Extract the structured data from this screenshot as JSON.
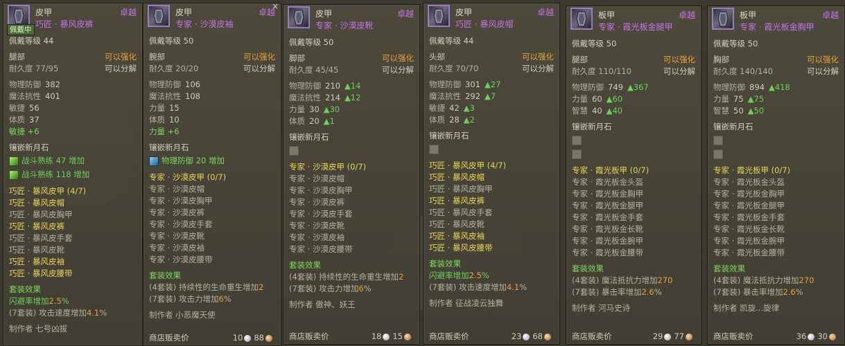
{
  "tooltips": [
    {
      "type": "皮甲",
      "rarity": "卓越",
      "name": "巧匠 · 暴风皮裤",
      "equipped": "佩戴中",
      "icon": "leather-pants-icon",
      "level_label": "佩戴等级 44",
      "slot": "腿部",
      "enhance": "可以强化",
      "durability": "耐久度 77/95",
      "decompose": "可以分解",
      "stats": [
        {
          "name": "物理防御",
          "value": "382"
        },
        {
          "name": "魔法抗性",
          "value": "401"
        },
        {
          "name": "敏捷",
          "value": "56"
        },
        {
          "name": "体质",
          "value": "37"
        }
      ],
      "bonus": "敏捷 +6",
      "socket_title": "镶嵌新月石",
      "gems": [
        {
          "text": "战斗熟练 47 增加",
          "color": "green"
        },
        {
          "text": "战斗熟练 118 增加",
          "color": "green"
        }
      ],
      "set_name": "巧匠 · 暴风皮甲 (4/7)",
      "set_items": [
        {
          "text": "巧匠 · 暴风皮帽",
          "active": true
        },
        {
          "text": "巧匠 · 暴风皮胸甲",
          "active": false
        },
        {
          "text": "巧匠 · 暴风皮裤",
          "active": true
        },
        {
          "text": "巧匠 · 暴风皮手套",
          "active": false
        },
        {
          "text": "巧匠 · 暴风皮靴",
          "active": false
        },
        {
          "text": "巧匠 · 暴风皮袖",
          "active": true
        },
        {
          "text": "巧匠 · 暴风皮腰带",
          "active": true
        }
      ],
      "set_effect_title": "套装效果",
      "set_effects": [
        {
          "prefix": "闪避率增加",
          "value": "2.5",
          "suffix": "%",
          "active": true
        },
        {
          "prefix": "(7套装) 攻击速度增加",
          "value": "4.1",
          "suffix": "%",
          "active": false
        }
      ],
      "maker": "制作者 七号凶拔",
      "price_label": "",
      "silver": "",
      "copper": ""
    },
    {
      "type": "皮甲",
      "rarity": "卓越",
      "name": "专家 · 沙漠皮袖",
      "equipped": "",
      "icon": "leather-sleeve-icon",
      "level_label": "佩戴等级 50",
      "slot": "腕部",
      "enhance": "可以强化",
      "durability": "耐久度 20/20",
      "decompose": "可以分解",
      "stats": [
        {
          "name": "物理防御",
          "value": "106"
        },
        {
          "name": "魔法抗性",
          "value": "108"
        },
        {
          "name": "力量",
          "value": "15"
        },
        {
          "name": "体质",
          "value": "10"
        }
      ],
      "bonus": "力量 +6",
      "socket_title": "镶嵌新月石",
      "gems": [
        {
          "text": "物理防御 20 增加",
          "color": "blue"
        }
      ],
      "set_name": "专家 · 沙漠皮甲 (0/7)",
      "set_items": [
        {
          "text": "专家 · 沙漠皮帽",
          "active": false
        },
        {
          "text": "专家 · 沙漠皮胸甲",
          "active": false
        },
        {
          "text": "专家 · 沙漠皮裤",
          "active": false
        },
        {
          "text": "专家 · 沙漠皮手套",
          "active": false
        },
        {
          "text": "专家 · 沙漠皮靴",
          "active": false
        },
        {
          "text": "专家 · 沙漠皮袖",
          "active": false
        },
        {
          "text": "专家 · 沙漠皮腰带",
          "active": false
        }
      ],
      "set_effect_title": "套装效果",
      "set_effects": [
        {
          "prefix": "(4套装) 持续性的生命重生增加",
          "value": "2",
          "suffix": "",
          "active": false
        },
        {
          "prefix": "(7套装) 攻击力增加",
          "value": "6",
          "suffix": "%",
          "active": false
        }
      ],
      "maker": "制作者 小恶魔天使",
      "price_label": "商店贩卖价",
      "silver": "10",
      "copper": "88"
    },
    {
      "type": "皮甲",
      "rarity": "卓越",
      "name": "专家 · 沙漠皮靴",
      "equipped": "",
      "icon": "leather-boots-icon",
      "level_label": "佩戴等级 50",
      "slot": "脚部",
      "enhance": "可以强化",
      "durability": "耐久度 45/45",
      "decompose": "可以分解",
      "stats": [
        {
          "name": "物理防御",
          "value": "210",
          "up": "▲14"
        },
        {
          "name": "魔法抗性",
          "value": "214",
          "up": "▲12"
        },
        {
          "name": "力量",
          "value": "30",
          "up": "▲30"
        },
        {
          "name": "体质",
          "value": "20",
          "up": "▲1"
        }
      ],
      "bonus": "",
      "socket_title": "镶嵌新月石",
      "gems": [
        {
          "text": "",
          "color": "empty"
        }
      ],
      "set_name": "专家 · 沙漠皮甲 (0/7)",
      "set_items": [
        {
          "text": "专家 · 沙漠皮帽",
          "active": false
        },
        {
          "text": "专家 · 沙漠皮胸甲",
          "active": false
        },
        {
          "text": "专家 · 沙漠皮裤",
          "active": false
        },
        {
          "text": "专家 · 沙漠皮手套",
          "active": false
        },
        {
          "text": "专家 · 沙漠皮靴",
          "active": false
        },
        {
          "text": "专家 · 沙漠皮袖",
          "active": false
        },
        {
          "text": "专家 · 沙漠皮腰带",
          "active": false
        }
      ],
      "set_effect_title": "套装效果",
      "set_effects": [
        {
          "prefix": "(4套装) 持续性的生命重生增加",
          "value": "2",
          "suffix": "",
          "active": false
        },
        {
          "prefix": "(7套装) 攻击力增加",
          "value": "6",
          "suffix": "%",
          "active": false
        }
      ],
      "maker": "制作者 傲神、妖王",
      "price_label": "商店贩卖价",
      "silver": "18",
      "copper": "15"
    },
    {
      "type": "皮甲",
      "rarity": "卓越",
      "name": "巧匠 · 暴风皮帽",
      "equipped": "",
      "icon": "leather-hat-icon",
      "level_label": "佩戴等级 44",
      "slot": "头部",
      "enhance": "可以强化",
      "durability": "耐久度 70/70",
      "decompose": "可以分解",
      "stats": [
        {
          "name": "物理防御",
          "value": "301",
          "up": "▲27"
        },
        {
          "name": "魔法抗性",
          "value": "292",
          "up": "▲7"
        },
        {
          "name": "敏捷",
          "value": "42",
          "up": "▲3"
        },
        {
          "name": "体质",
          "value": "28",
          "up": "▲2"
        }
      ],
      "bonus": "",
      "socket_title": "镶嵌新月石",
      "gems": [
        {
          "text": "",
          "color": "empty"
        }
      ],
      "set_name": "巧匠 · 暴风皮甲 (4/7)",
      "set_items": [
        {
          "text": "巧匠 · 暴风皮帽",
          "active": true
        },
        {
          "text": "巧匠 · 暴风皮胸甲",
          "active": false
        },
        {
          "text": "巧匠 · 暴风皮裤",
          "active": true
        },
        {
          "text": "巧匠 · 暴风皮手套",
          "active": false
        },
        {
          "text": "巧匠 · 暴风皮靴",
          "active": false
        },
        {
          "text": "巧匠 · 暴风皮袖",
          "active": true
        },
        {
          "text": "巧匠 · 暴风皮腰带",
          "active": true
        }
      ],
      "set_effect_title": "套装效果",
      "set_effects": [
        {
          "prefix": "闪避率增加",
          "value": "2.5",
          "suffix": "%",
          "active": true
        },
        {
          "prefix": "(7套装) 攻击速度增加",
          "value": "4.1",
          "suffix": "%",
          "active": false
        }
      ],
      "maker": "制作者 征战凌云独舞",
      "price_label": "商店贩卖价",
      "silver": "23",
      "copper": "68"
    },
    {
      "type": "板甲",
      "rarity": "卓越",
      "name": "专家 · 霞光板金腿甲",
      "equipped": "",
      "icon": "plate-greaves-icon",
      "level_label": "佩戴等级 50",
      "slot": "腿部",
      "enhance": "可以强化",
      "durability": "耐久度 110/110",
      "decompose": "可以分解",
      "stats": [
        {
          "name": "物理防御",
          "value": "749",
          "up": "▲367"
        },
        {
          "name": "力量",
          "value": "60",
          "up": "▲60"
        },
        {
          "name": "智慧",
          "value": "40",
          "up": "▲40"
        }
      ],
      "bonus": "",
      "socket_title": "镶嵌新月石",
      "gems": [
        {
          "text": "",
          "color": "empty"
        },
        {
          "text": "",
          "color": "empty"
        }
      ],
      "set_name": "专家 · 霞光板甲 (0/7)",
      "set_items": [
        {
          "text": "专家 · 霞光板金头盔",
          "active": false
        },
        {
          "text": "专家 · 霞光板金胸甲",
          "active": false
        },
        {
          "text": "专家 · 霞光板金腿甲",
          "active": false
        },
        {
          "text": "专家 · 霞光板金手套",
          "active": false
        },
        {
          "text": "专家 · 霞光板金长靴",
          "active": false
        },
        {
          "text": "专家 · 霞光板金腕甲",
          "active": false
        },
        {
          "text": "专家 · 霞光板金腰带",
          "active": false
        }
      ],
      "set_effect_title": "套装效果",
      "set_effects": [
        {
          "prefix": "(4套装) 魔法抵抗力增加",
          "value": "270",
          "suffix": "",
          "active": false
        },
        {
          "prefix": "(7套装) 暴击率增加",
          "value": "2.6",
          "suffix": "%",
          "active": false
        }
      ],
      "maker": "制作者 河马史诗",
      "price_label": "商店贩卖价",
      "silver": "29",
      "copper": "77"
    },
    {
      "type": "板甲",
      "rarity": "卓越",
      "name": "专家 · 霞光板金胸甲",
      "equipped": "",
      "icon": "plate-chest-icon",
      "level_label": "佩戴等级 50",
      "slot": "胸部",
      "enhance": "可以强化",
      "durability": "耐久度 140/140",
      "decompose": "可以分解",
      "stats": [
        {
          "name": "物理防御",
          "value": "894",
          "up": "▲418"
        },
        {
          "name": "力量",
          "value": "75",
          "up": "▲75"
        },
        {
          "name": "智慧",
          "value": "50",
          "up": "▲50"
        }
      ],
      "bonus": "",
      "socket_title": "镶嵌新月石",
      "gems": [
        {
          "text": "",
          "color": "empty"
        },
        {
          "text": "",
          "color": "empty"
        }
      ],
      "set_name": "专家 · 霞光板甲 (0/7)",
      "set_items": [
        {
          "text": "专家 · 霞光板金头盔",
          "active": false
        },
        {
          "text": "专家 · 霞光板金胸甲",
          "active": false
        },
        {
          "text": "专家 · 霞光板金腿甲",
          "active": false
        },
        {
          "text": "专家 · 霞光板金手套",
          "active": false
        },
        {
          "text": "专家 · 霞光板金长靴",
          "active": false
        },
        {
          "text": "专家 · 霞光板金腕甲",
          "active": false
        },
        {
          "text": "专家 · 霞光板金腰带",
          "active": false
        }
      ],
      "set_effect_title": "套装效果",
      "set_effects": [
        {
          "prefix": "(4套装) 魔法抵抗力增加",
          "value": "270",
          "suffix": "",
          "active": false
        },
        {
          "prefix": "(7套装) 暴击率增加",
          "value": "2.6",
          "suffix": "%",
          "active": false
        }
      ],
      "maker": "制作者 凯旋...旋律",
      "price_label": "商店贩卖价",
      "silver": "36",
      "copper": "30"
    }
  ],
  "close_glyph": "×",
  "colors": {
    "rarity": "#c474e6",
    "gold": "#e8a23a",
    "green": "#6ed05a",
    "yellow": "#e8d55a"
  }
}
